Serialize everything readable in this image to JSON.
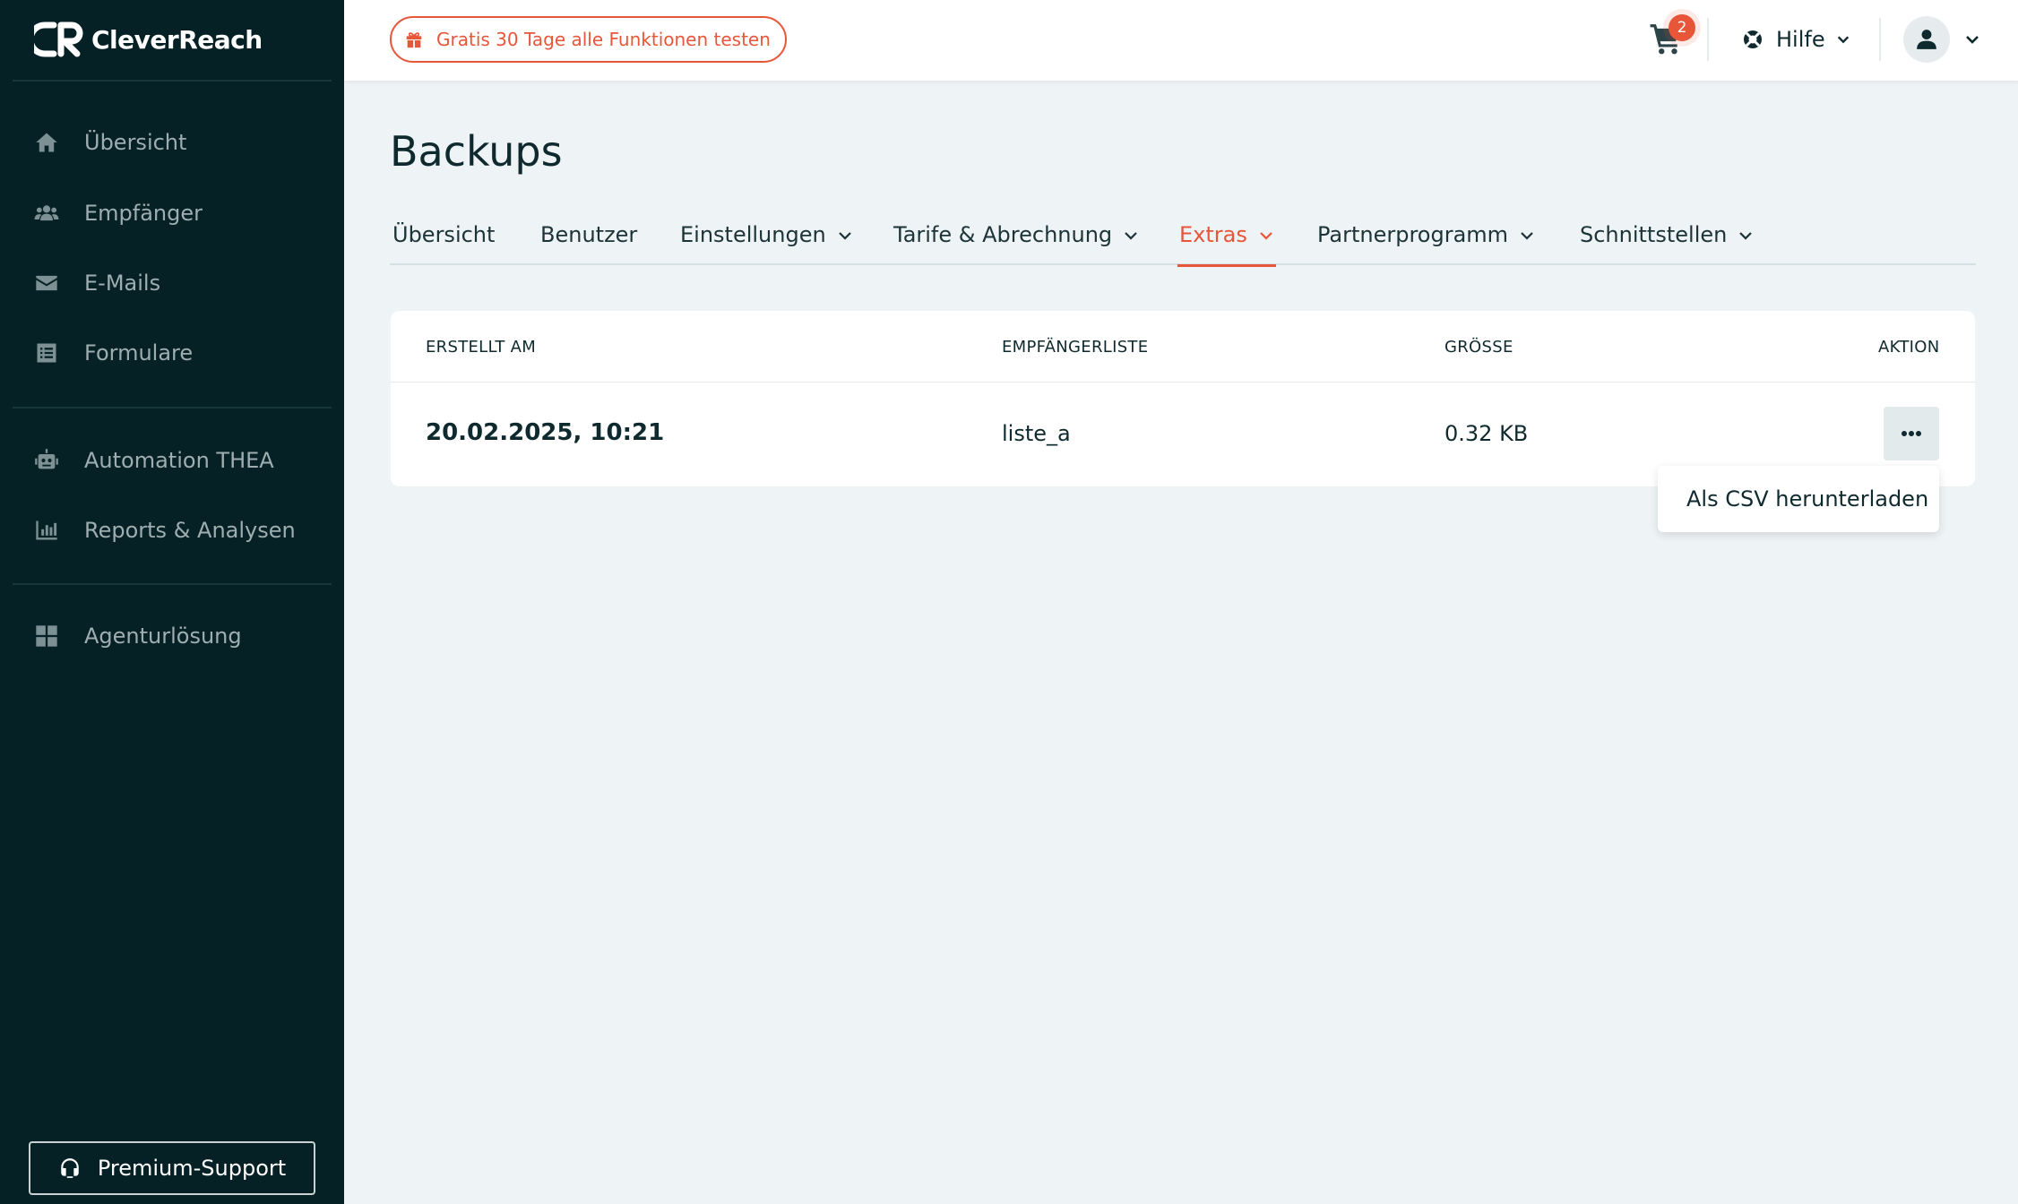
{
  "brand": {
    "name": "CleverReach"
  },
  "sidebar": {
    "items": [
      {
        "label": "Übersicht",
        "icon": "home-icon"
      },
      {
        "label": "Empfänger",
        "icon": "users-icon"
      },
      {
        "label": "E-Mails",
        "icon": "envelope-icon"
      },
      {
        "label": "Formulare",
        "icon": "form-icon"
      },
      {
        "label": "Automation THEA",
        "icon": "robot-icon"
      },
      {
        "label": "Reports & Analysen",
        "icon": "bar-chart-icon"
      },
      {
        "label": "Agenturlösung",
        "icon": "grid-icon"
      }
    ],
    "premium_support": "Premium-Support"
  },
  "topbar": {
    "promo": "Gratis 30 Tage alle Funktionen testen",
    "cart_count": "2",
    "help": "Hilfe"
  },
  "page": {
    "title": "Backups",
    "tabs": [
      {
        "label": "Übersicht",
        "has_dropdown": false
      },
      {
        "label": "Benutzer",
        "has_dropdown": false
      },
      {
        "label": "Einstellungen",
        "has_dropdown": true
      },
      {
        "label": "Tarife & Abrechnung",
        "has_dropdown": true
      },
      {
        "label": "Extras",
        "has_dropdown": true,
        "active": true
      },
      {
        "label": "Partnerprogramm",
        "has_dropdown": true
      },
      {
        "label": "Schnittstellen",
        "has_dropdown": true
      }
    ]
  },
  "table": {
    "columns": [
      "ERSTELLT AM",
      "EMPFÄNGERLISTE",
      "GRÖSSE",
      "AKTION"
    ],
    "rows": [
      {
        "created": "20.02.2025, 10:21",
        "list": "liste_a",
        "size": "0.32 KB"
      }
    ]
  },
  "action_menu": {
    "items": [
      "Als CSV herunterladen"
    ]
  },
  "colors": {
    "sidebar_bg": "#062126",
    "accent": "#e8563a",
    "page_bg": "#eef3f5"
  }
}
